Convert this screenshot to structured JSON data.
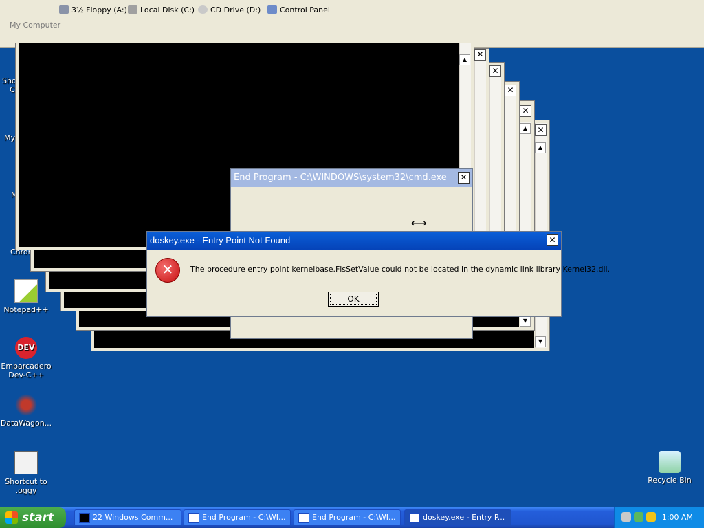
{
  "toolbar": {
    "title": "My Computer",
    "drives": [
      {
        "label": "3½ Floppy (A:)",
        "icon": "floppy-icon"
      },
      {
        "label": "Local Disk (C:)",
        "icon": "hard-disk-icon"
      },
      {
        "label": "CD Drive (D:)",
        "icon": "cd-drive-icon"
      },
      {
        "label": "Control Panel",
        "icon": "control-panel-icon"
      }
    ]
  },
  "desktop_icons": [
    {
      "label": "Notepad++",
      "icon": "notepadpp-icon"
    },
    {
      "label": "Embarcadero Dev-C++",
      "icon": "devcpp-icon"
    },
    {
      "label": "DataWagon...",
      "icon": "datawagon-icon"
    },
    {
      "label": "Shortcut to .oggy",
      "icon": "shortcut-icon"
    },
    {
      "label": "Recycle Bin",
      "icon": "recycle-bin-icon"
    }
  ],
  "partial_labels": [
    "Sho",
    "C",
    "My",
    "M",
    "Chron"
  ],
  "end_program": {
    "title": "End Program - C:\\WINDOWS\\system32\\cmd.exe"
  },
  "error_dialog": {
    "title": "doskey.exe - Entry Point Not Found",
    "message": "The procedure entry point kernelbase.FlsSetValue could not be located in the dynamic link library Kernel32.dll.",
    "ok_label": "OK"
  },
  "taskbar": {
    "start_label": "start",
    "buttons": [
      {
        "label": "22 Windows Comm...",
        "active": false
      },
      {
        "label": "End Program - C:\\WI...",
        "active": false
      },
      {
        "label": "End Program - C:\\WI...",
        "active": false
      },
      {
        "label": "doskey.exe - Entry P...",
        "active": true
      }
    ],
    "clock": "1:00 AM"
  },
  "glyphs": {
    "close": "✕",
    "max": "☐",
    "min": "_",
    "up": "▲",
    "down": "▼",
    "error": "✕",
    "cursor": "⟷"
  }
}
